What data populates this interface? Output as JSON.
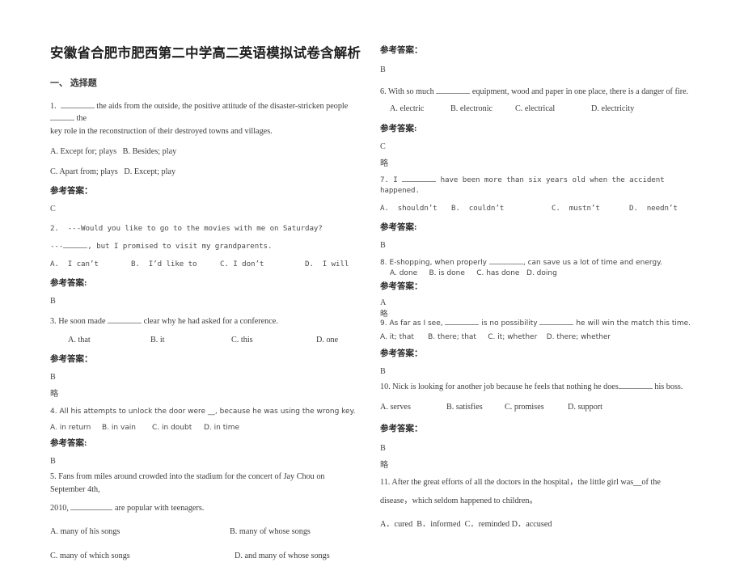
{
  "document": {
    "title": "安徽省合肥市肥西第二中学高二英语模拟试卷含解析",
    "section_heading": "一、 选择题",
    "answer_label": "参考答案：",
    "answer_label_alt": "参考答案:",
    "omitted_mark": "略"
  },
  "left_column": {
    "q1": {
      "stem_a": "1.  ",
      "stem_b": " the aids from the outside, the positive attitude of the disaster-stricken people ",
      "stem_c": " the",
      "stem_line2": "key role in the reconstruction of their destroyed towns and villages.",
      "options_line1": "A. Except for; plays   B. Besides; play",
      "options_line2": "C. Apart from; plays   D. Except; play",
      "answer": "C"
    },
    "q2": {
      "stem_line1": "2.  ---Would you like to go to the movies with me on Saturday?",
      "stem_line2_a": "---",
      "stem_line2_b": ", but I promised to visit my grandparents.",
      "opt_a": "A.  I can’t",
      "opt_b": "B.  I’d like to",
      "opt_c": "C. I don’t",
      "opt_d": "D.  I will",
      "answer": "B"
    },
    "q3": {
      "stem_a": "3. He soon made ",
      "stem_b": " clear why he had asked for a conference.",
      "opt_a": "A. that",
      "opt_b": "B. it",
      "opt_c": "C. this",
      "opt_d": "D. one",
      "answer": "B",
      "omitted": "略"
    },
    "q4": {
      "stem": "4. All his attempts to unlock the door were __, because he was using the wrong key.",
      "opt_a": "A. in return",
      "opt_b": "B. in vain",
      "opt_c": "C. in doubt",
      "opt_d": "D. in time",
      "answer": "B"
    },
    "q5": {
      "stem_line1": "5. Fans from miles around crowded into the stadium for the concert of Jay Chou on September 4th,",
      "stem_line2_a": "2010, ",
      "stem_line2_b": " are popular with teenagers.",
      "opt_a": "A. many of his songs",
      "opt_b": "B. many of whose songs",
      "opt_c": "C. many of which songs",
      "opt_d": "D. and many of whose songs"
    }
  },
  "right_column": {
    "carryover_answer": {
      "label": "参考答案：",
      "value": "B"
    },
    "q6": {
      "stem_a": "6. With so much ",
      "stem_b": " equipment, wood and paper in one place, there is a danger of fire.",
      "opt_a": "A. electric",
      "opt_b": "B. electronic",
      "opt_c": "C. electrical",
      "opt_d": "D. electricity",
      "answer": "C",
      "omitted": "略"
    },
    "q7": {
      "stem_a": "7. I ",
      "stem_b": " have been more than six years old when the accident happened.",
      "opt_a": "A.  shouldn’t",
      "opt_b": "B.  couldn’t",
      "opt_c": "C.  mustn’t",
      "opt_d": "D.  needn’t",
      "answer": "B"
    },
    "q8": {
      "stem_a": "8. E-shopping, when properly ",
      "stem_b": ", can save us a lot of time and energy.",
      "options": "A. done     B. is done     C. has done   D. doing",
      "answer": "A",
      "omitted": "略"
    },
    "q9": {
      "stem_a": "9. As far as I see, ",
      "stem_b": " is no possibility ",
      "stem_c": " he will win the match this time.",
      "options": "A. it; that      B. there; that     C. it; whether    D. there; whether",
      "answer": "B"
    },
    "q10": {
      "stem_a": "10. Nick is looking for another job because he feels that nothing he does",
      "stem_b": " his boss.",
      "opt_a": "A. serves",
      "opt_b": "B. satisfies",
      "opt_c": "C. promises",
      "opt_d": "D. support",
      "answer": "B",
      "omitted": "略"
    },
    "q11": {
      "stem_line1": "11. After the great efforts of all the doctors in the hospital，the little girl was__of the",
      "stem_line2": "disease，which seldom happened to children。",
      "options": "A．cured  B．informed  C．reminded D．accused"
    }
  }
}
